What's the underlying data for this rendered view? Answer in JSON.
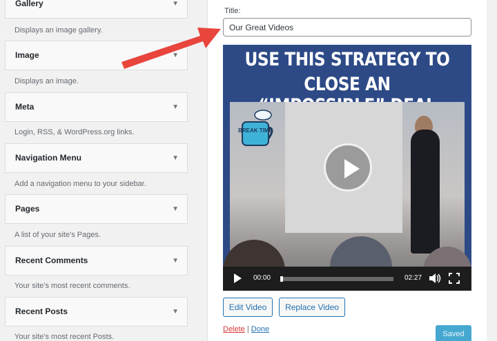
{
  "widgets": [
    {
      "title": "Gallery",
      "description": "Displays an image gallery."
    },
    {
      "title": "Image",
      "description": "Displays an image."
    },
    {
      "title": "Meta",
      "description": "Login, RSS, & WordPress.org links."
    },
    {
      "title": "Navigation Menu",
      "description": "Add a navigation menu to your sidebar."
    },
    {
      "title": "Pages",
      "description": "A list of your site's Pages."
    },
    {
      "title": "Recent Comments",
      "description": "Your site's most recent comments."
    },
    {
      "title": "Recent Posts",
      "description": "Your site's most recent Posts."
    }
  ],
  "widget_arrow": "▼",
  "form": {
    "title_label": "Title:",
    "title_value": "Our Great Videos"
  },
  "video": {
    "headline_line1": "USE THIS STRATEGY TO",
    "headline_line2": "CLOSE AN “IMPOSSIBLE” DEAL",
    "badge_text": "BREAK TIME",
    "current_time": "00:00",
    "duration": "02:27",
    "progress": 0
  },
  "buttons": {
    "edit": "Edit Video",
    "replace": "Replace Video",
    "delete": "Delete",
    "separator": "|",
    "done": "Done",
    "saved": "Saved"
  },
  "colors": {
    "accent": "#2271b1",
    "danger": "#d63638",
    "annotation_arrow": "#e8453c",
    "video_banner": "#2d4a86"
  }
}
